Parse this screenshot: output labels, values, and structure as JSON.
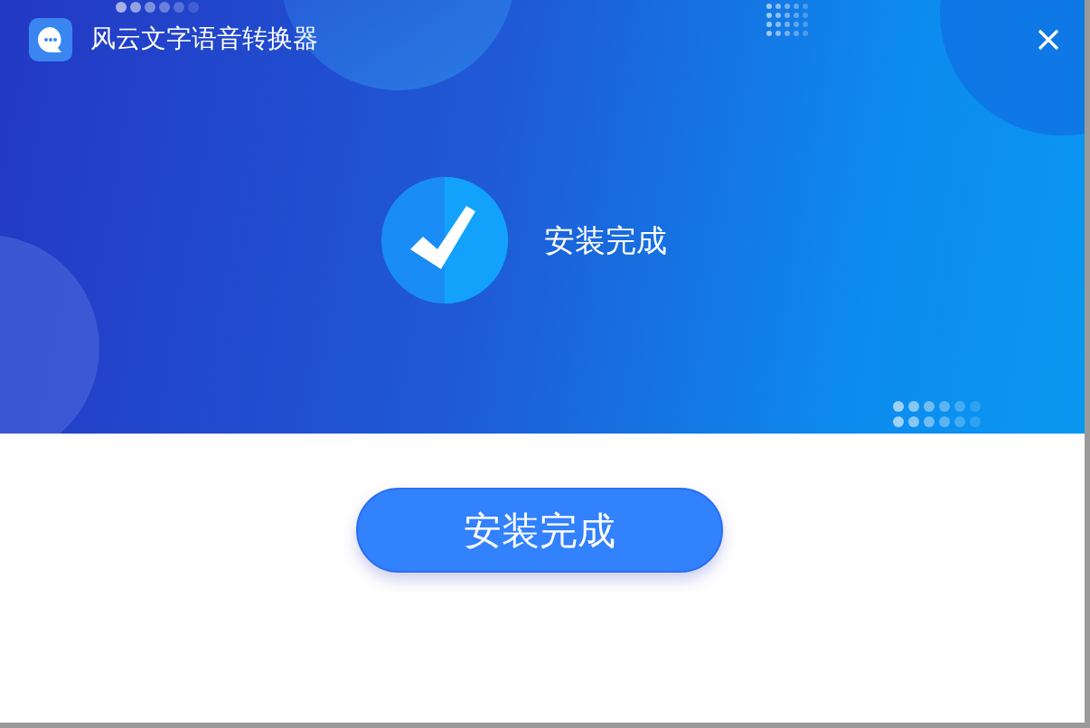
{
  "window": {
    "title": "风云文字语音转换器"
  },
  "status": {
    "text": "安装完成"
  },
  "buttons": [
    {
      "label": "安装完成"
    }
  ]
}
